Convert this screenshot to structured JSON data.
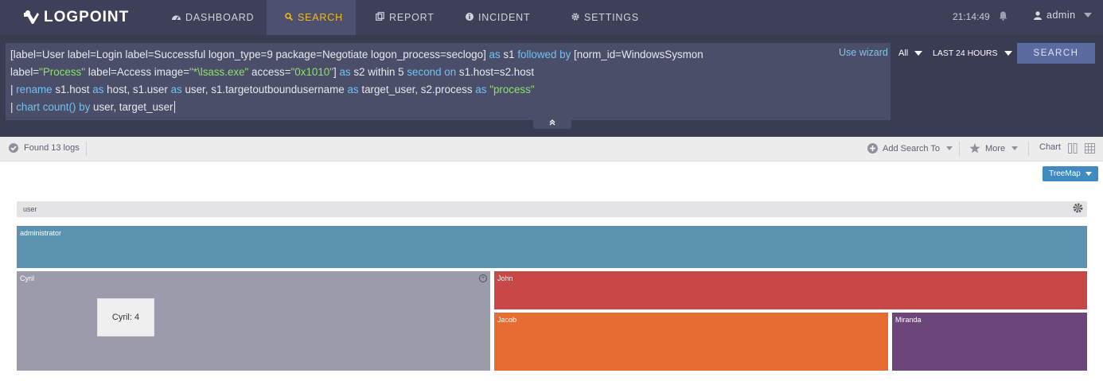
{
  "header": {
    "brand": "LOGPOINT",
    "nav": [
      {
        "label": "DASHBOARD",
        "icon": "dashboard-icon"
      },
      {
        "label": "SEARCH",
        "icon": "search-icon"
      },
      {
        "label": "REPORT",
        "icon": "report-icon"
      },
      {
        "label": "INCIDENT",
        "icon": "info-icon"
      },
      {
        "label": "SETTINGS",
        "icon": "gear-icon"
      }
    ],
    "active_tab": "SEARCH",
    "time": "21:14:49",
    "user": "admin"
  },
  "query": {
    "line1": {
      "a": "[label=User label=Login label=Successful logon_type=9 package=Negotiate logon_process=seclogo]",
      "b": "as",
      "c": "s1",
      "d": "followed by",
      "e": "[norm_id=WindowsSysmon"
    },
    "line2": {
      "a": "label=",
      "b": "\"Process\"",
      "c": "label=Access image=",
      "d": "\"*\\lsass.exe\"",
      "e": "access=",
      "f": "\"0x1010\"",
      "g": "]",
      "h": "as",
      "i": "s2 within 5",
      "j": "second",
      "k": "on",
      "l": "s1.host=s2.host"
    },
    "line3": {
      "a": "|",
      "b": "rename",
      "c": "s1.host",
      "d": "as",
      "e": "host, s1.user",
      "f": "as",
      "g": "user, s1.targetoutboundusername",
      "h": "as",
      "i": "target_user, s2.process",
      "j": "as",
      "k": "\"process\""
    },
    "line4": {
      "a": "|",
      "b": "chart count()",
      "c": "by",
      "d": "user, target_user"
    },
    "use_wizard": "Use wizard",
    "scope": "All",
    "timerange": "LAST 24 HOURS",
    "search_button": "SEARCH"
  },
  "results": {
    "found": "Found 13 logs",
    "add_search_to": "Add Search To",
    "more": "More",
    "chart": "Chart"
  },
  "viz": {
    "type_button": "TreeMap",
    "field": "user",
    "tooltip": "Cyril: 4"
  },
  "chart_data": {
    "type": "treemap",
    "field": "user",
    "items": [
      {
        "name": "administrator",
        "color": "#5a92af"
      },
      {
        "name": "Cyril",
        "value": 4,
        "color": "#9b9bab"
      },
      {
        "name": "John",
        "color": "#c84848"
      },
      {
        "name": "Jacob",
        "color": "#e66c31"
      },
      {
        "name": "Miranda",
        "color": "#6c4678"
      }
    ]
  },
  "colors": {
    "topbar": "#3e4059",
    "active_tab_text": "#f5b915",
    "query_keyword": "#6fc2f0",
    "query_string": "#8ee26c",
    "search_button": "#5b6ba0",
    "treemap_button": "#3f8ac0"
  }
}
